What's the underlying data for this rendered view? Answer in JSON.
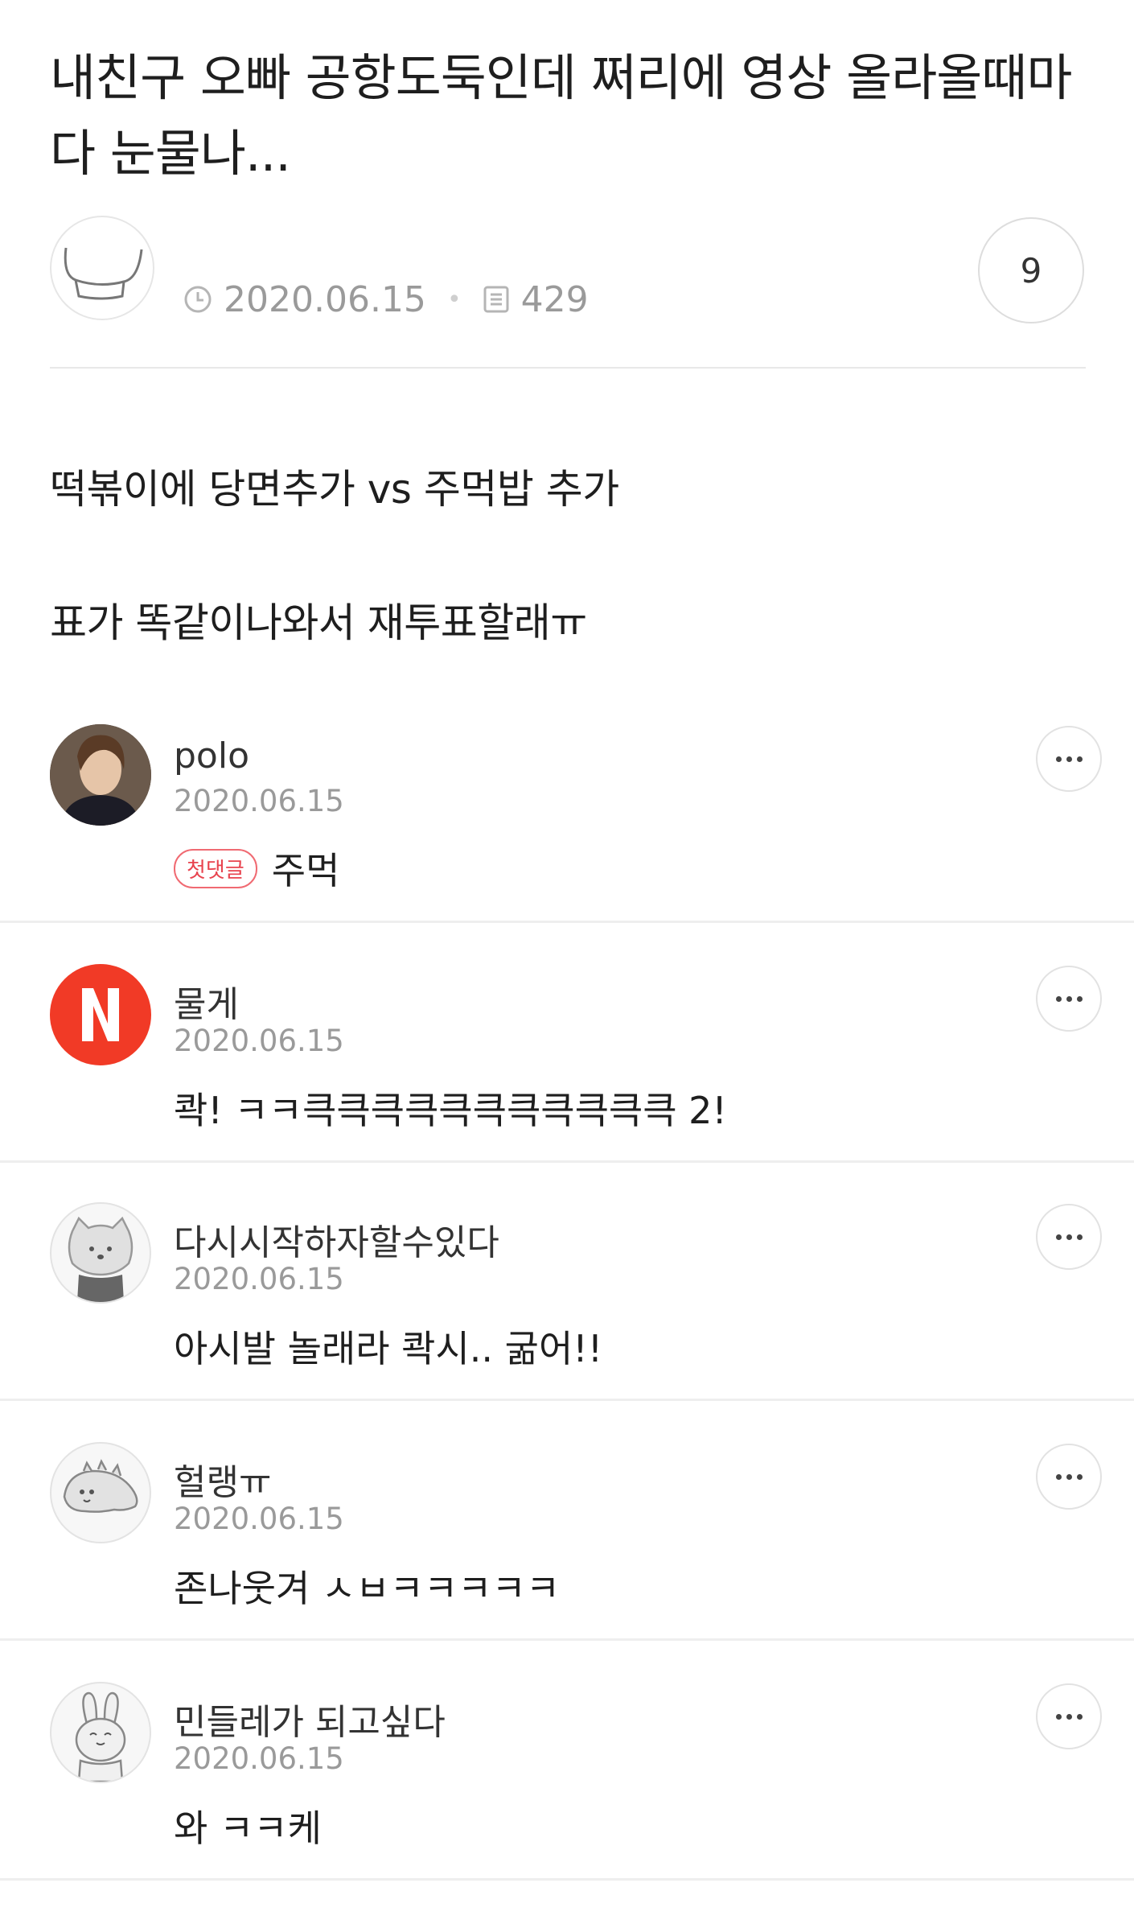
{
  "post": {
    "title": "내친구 오빠 공항도둑인데 쩌리에 영상 올라올때마다 눈물나...",
    "date": "2020.06.15",
    "views": "429",
    "comment_count": "9",
    "body": [
      "떡볶이에 당면추가 vs 주먹밥 추가",
      "표가 똑같이나와서 재투표할래ㅠ"
    ]
  },
  "icons": {
    "author_avatar": "cartoon-avatar-icon",
    "date": "clock-icon",
    "views": "document-icon",
    "more": "more-options-icon"
  },
  "comments": [
    {
      "name": "polo",
      "date": "2020.06.15",
      "badge": "첫댓글",
      "text": "주먹",
      "avatar": "photo"
    },
    {
      "name": "물게",
      "date": "2020.06.15",
      "text": "콱! ㅋㅋ큭큭큭큭큭큭큭큭큭큭큭 2!",
      "avatar": "netflix-n"
    },
    {
      "name": "다시시작하자할수있다",
      "date": "2020.06.15",
      "text": "아시발 놀래라 콱시.. 굶어!!",
      "avatar": "cat"
    },
    {
      "name": "헐랭ㅠ",
      "date": "2020.06.15",
      "text": "존나웃겨 ㅅㅂㅋㅋㅋㅋㅋ",
      "avatar": "dino"
    },
    {
      "name": "민들레가 되고싶다",
      "date": "2020.06.15",
      "text": "와 ㅋㅋ케",
      "avatar": "rabbit"
    }
  ],
  "colors": {
    "first_badge": "#e8434e",
    "netflix_red": "#f13a26",
    "meta_gray": "#9a9a9a"
  }
}
